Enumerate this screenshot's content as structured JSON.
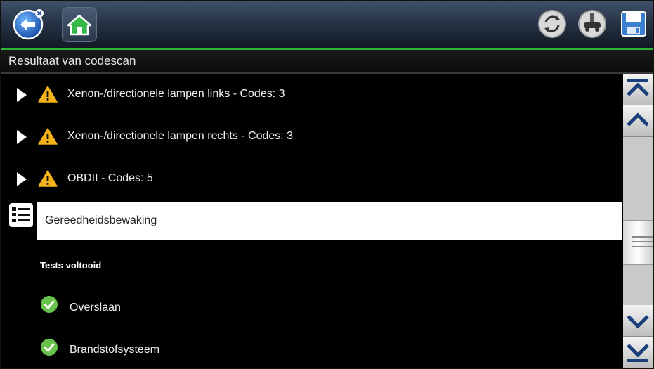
{
  "toolbar": {
    "back_icon": "back-arrow-icon",
    "home_icon": "home-icon",
    "refresh_icon": "refresh-icon",
    "connection_icon": "vehicle-connection-icon",
    "save_icon": "save-icon",
    "accent_color": "#2fb332"
  },
  "title": "Resultaat van codescan",
  "items": [
    {
      "label": "Xenon-/directionele lampen links - Codes: 3",
      "icon": "warning-icon"
    },
    {
      "label": "Xenon-/directionele lampen rechts - Codes: 3",
      "icon": "warning-icon"
    },
    {
      "label": "OBDII - Codes: 5",
      "icon": "warning-icon"
    }
  ],
  "selected": {
    "label": "Gereedheidsbewaking",
    "icon": "checklist-icon"
  },
  "section_title": "Tests voltooid",
  "tests": [
    {
      "label": "Overslaan",
      "icon": "check-icon"
    },
    {
      "label": "Brandstofsysteem",
      "icon": "check-icon"
    }
  ]
}
